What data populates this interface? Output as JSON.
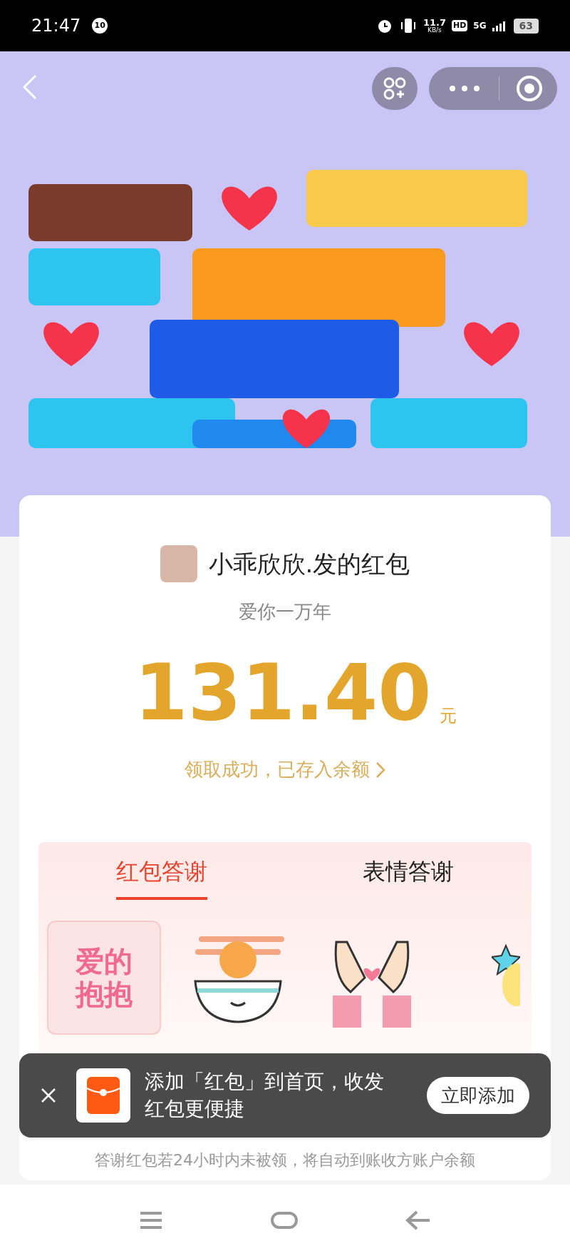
{
  "status_bar": {
    "time": "21:47",
    "notification_count": "10",
    "speed_value": "11.7",
    "speed_unit": "KB/s",
    "hd": "HD",
    "network": "5G",
    "battery": "63"
  },
  "packet": {
    "sender_title": "小乖欣欣.发的红包",
    "message": "爱你一万年",
    "amount": "131.40",
    "currency": "元",
    "status_link": "领取成功，已存入余额"
  },
  "thanks_tabs": [
    {
      "label": "红包答谢",
      "selected": true
    },
    {
      "label": "表情答谢",
      "selected": false
    }
  ],
  "gifts": [
    {
      "kind": "hug",
      "sticker_text": "爱的抱抱",
      "selected": true
    },
    {
      "kind": "drumstick",
      "selected": false
    },
    {
      "kind": "heart_hands",
      "selected": false
    },
    {
      "kind": "star",
      "selected": false
    }
  ],
  "toast": {
    "text": "添加「红包」到首页，收发红包更便捷",
    "button": "立即添加"
  },
  "footer_note": "答谢红包若24小时内未被领，将自动到账收方账户余额"
}
